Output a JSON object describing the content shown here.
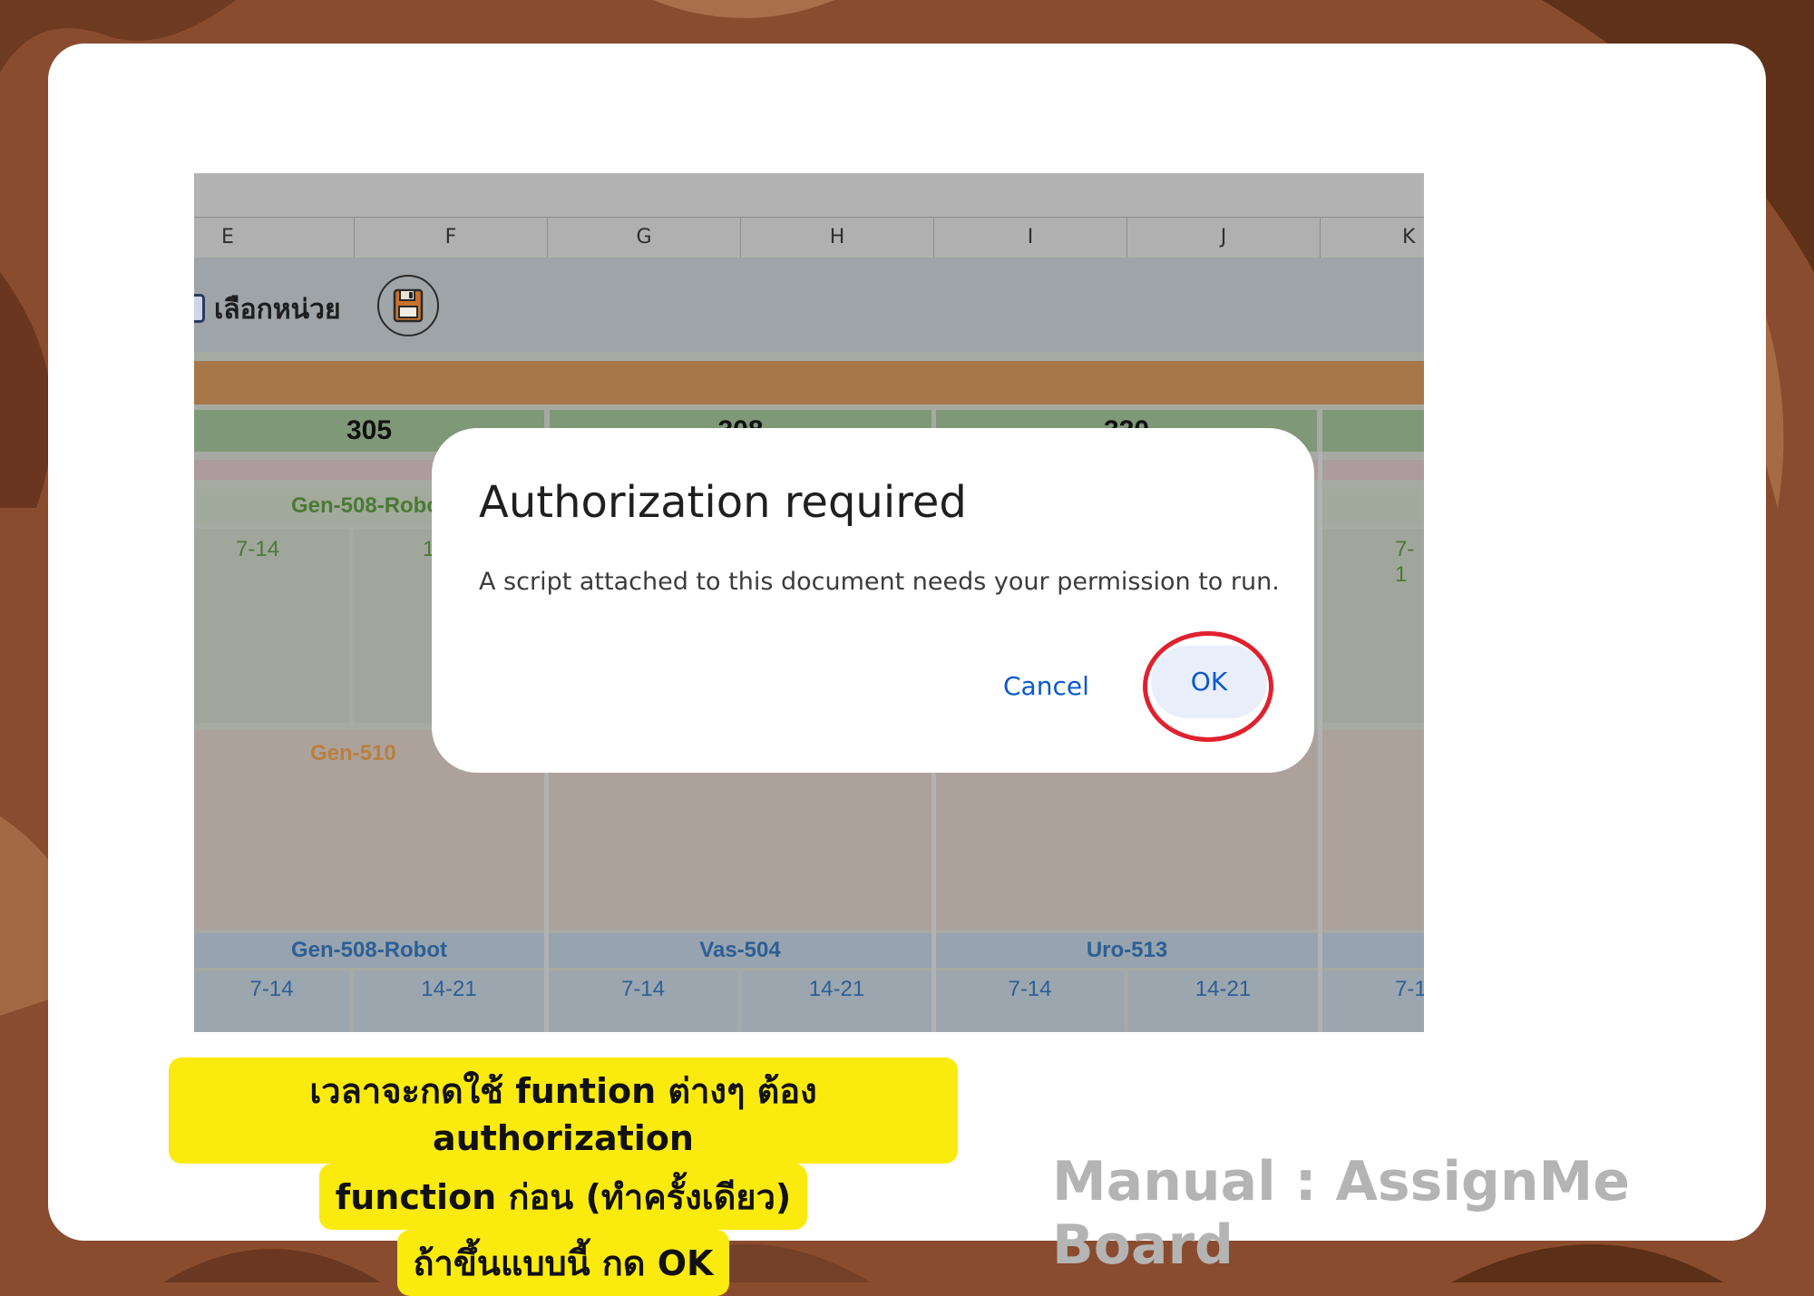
{
  "sheet": {
    "columns": [
      "E",
      "F",
      "G",
      "H",
      "I",
      "J",
      "K"
    ],
    "unit_select_label": "เลือกหน่วย",
    "rooms": [
      "305",
      "308",
      "320"
    ],
    "procedures_top": [
      "Gen-508-Robot"
    ],
    "shift_left": "7-14",
    "shift_partial": "1",
    "shift_right_partial": "7-1",
    "procedure_mid": "Gen-510",
    "procedures_bottom": [
      "Gen-508-Robot",
      "Vas-504",
      "Uro-513"
    ],
    "shifts_bottom": [
      "7-14",
      "14-21",
      "7-14",
      "14-21",
      "7-14",
      "14-21",
      "7-1"
    ]
  },
  "dialog": {
    "title": "Authorization required",
    "message": "A script attached to this document needs your permission to run.",
    "cancel_label": "Cancel",
    "ok_label": "OK"
  },
  "caption": {
    "line1": "เวลาจะกดใช้ funtion ต่างๆ ต้อง authorization",
    "line2": "function ก่อน (ทำครั้งเดียว)",
    "line3": "ถ้าขึ้นแบบนี้  กด OK"
  },
  "footer": {
    "manual_label": "Manual : AssignMe Board"
  },
  "colors": {
    "background": "#8a4c2e",
    "dialog_accent": "#0b57d0",
    "highlight_circle": "#e0212f",
    "caption_highlight": "#fbea0e"
  }
}
